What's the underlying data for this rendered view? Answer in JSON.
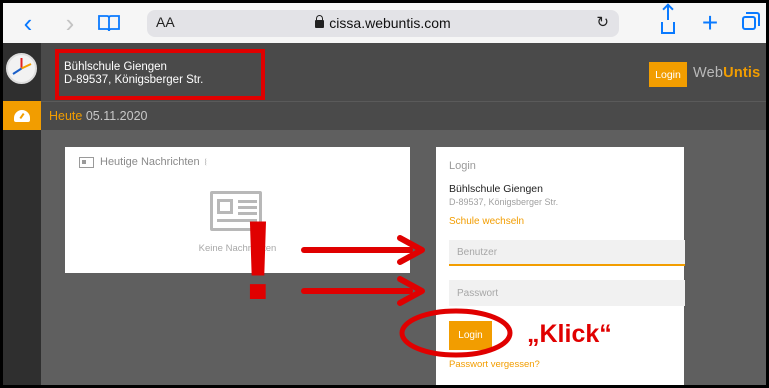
{
  "browser": {
    "reader_label": "AA",
    "url": "cissa.webuntis.com"
  },
  "header": {
    "school_name": "Bühlschule Giengen",
    "school_address": "D-89537, Königsberger Str.",
    "login_button": "Login",
    "brand_web": "Web",
    "brand_untis": "Untis"
  },
  "datebar": {
    "today_label": "Heute",
    "date": "05.11.2020"
  },
  "news": {
    "title": "Heutige Nachrichten",
    "empty_text": "Keine Nachrichten"
  },
  "login": {
    "title": "Login",
    "school_name": "Bühlschule Giengen",
    "school_address": "D-89537, Königsberger Str.",
    "switch_school": "Schule wechseln",
    "username_placeholder": "Benutzer",
    "password_placeholder": "Passwort",
    "submit": "Login",
    "forgot_password": "Passwort vergessen?"
  },
  "annotation": {
    "exclamation": "!",
    "click_label": "„Klick“",
    "color": "#e00000"
  },
  "colors": {
    "accent": "#f29d00",
    "header_bg": "#4a4a4a",
    "sidebar_bg": "#2f2f2f",
    "content_bg": "#5f5f5f",
    "safari_blue": "#0a7aff"
  }
}
